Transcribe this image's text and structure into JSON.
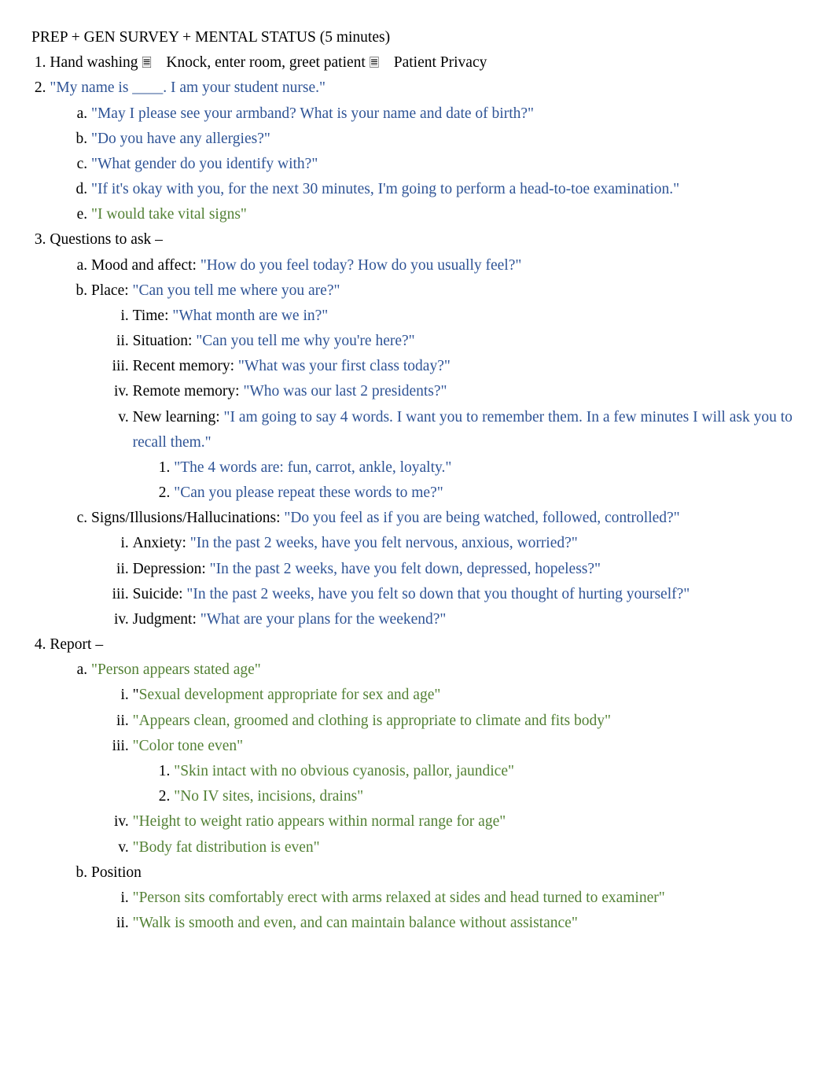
{
  "title": "PREP + GEN SURVEY + MENTAL STATUS (5 minutes)",
  "step1": {
    "a": "Hand washing",
    "b": "Knock, enter room, greet patient",
    "c": "Patient Privacy"
  },
  "step2": {
    "intro": "\"My name is ____. I am your student nurse.\"",
    "a": "\"May I please see your armband? What is your name and date of birth?\"",
    "b": "\"Do you have any allergies?\"",
    "c": "\"What gender do you identify with?\"",
    "d": "\"If it's okay with you, for the next 30 minutes, I'm going to perform a head-to-toe examination.\"",
    "e": "\"I would take vital signs\""
  },
  "step3": {
    "intro": "Questions to ask –",
    "a": {
      "label": "Mood and affect: ",
      "text": "\"How do you feel today? How do you usually feel?\""
    },
    "b": {
      "label": "Place: ",
      "text": "\"Can you tell me where you are?\"",
      "i": {
        "label": "Time: ",
        "text": "\"What month are we in?\""
      },
      "ii": {
        "label": "Situation: ",
        "text": "\"Can you tell me why you're here?\""
      },
      "iii": {
        "label": "Recent memory: ",
        "text": "\"What was your first class today?\""
      },
      "iv": {
        "label": "Remote memory: ",
        "text": "\"Who was our last 2 presidents?\""
      },
      "v": {
        "label": "New learning: ",
        "text": "\"I am going to say 4 words. I want you to remember them. In a few minutes I will ask you to recall them.\"",
        "n1": "\"The 4 words are: fun, carrot, ankle, loyalty.\"",
        "n2": "\"Can you please repeat these words to me?\""
      }
    },
    "c": {
      "label": "Signs/Illusions/Hallucinations: ",
      "text": "\"Do you feel as if you are being watched, followed, controlled?\"",
      "i": {
        "label": "Anxiety: ",
        "text": "\"In the past 2 weeks, have you felt nervous, anxious, worried?\""
      },
      "ii": {
        "label": "Depression: ",
        "text": "\"In the past 2 weeks, have you felt down, depressed, hopeless?\""
      },
      "iii": {
        "label": "Suicide: ",
        "text": "\"In the past 2 weeks, have you felt so down that you thought of hurting yourself?\""
      },
      "iv": {
        "label": "Judgment: ",
        "text": "\"What are your plans for the weekend?\""
      }
    }
  },
  "step4": {
    "intro": "Report –",
    "a": {
      "text": "\"Person appears stated age\"",
      "i": {
        "q": "\"",
        "text": "Sexual development appropriate for sex and age\""
      },
      "ii": "\"Appears clean, groomed and clothing is appropriate to climate and fits body\"",
      "iii": {
        "text": "\"Color tone even\"",
        "n1": "\"Skin intact with no obvious cyanosis, pallor, jaundice\"",
        "n2": "\"No IV sites, incisions, drains\""
      },
      "iv": "\"Height to weight ratio appears within normal range for age\"",
      "v": "\"Body fat distribution is even\""
    },
    "b": {
      "label": "Position",
      "i": " \"Person sits comfortably erect with arms relaxed at sides and head turned to examiner\"",
      "ii": "\"Walk is smooth and even, and can maintain balance without assistance\""
    }
  }
}
